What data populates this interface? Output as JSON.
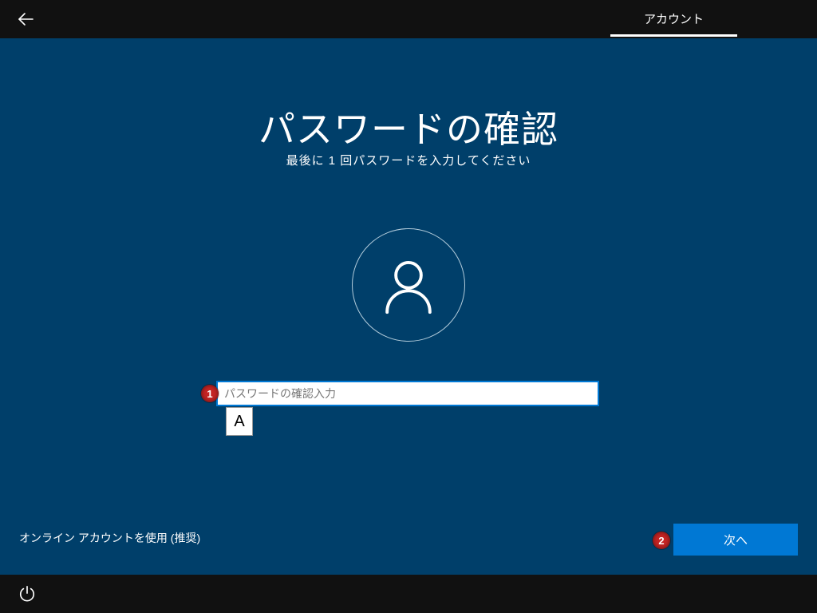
{
  "header": {
    "tab_label": "アカウント"
  },
  "main": {
    "title": "パスワードの確認",
    "subtitle": "最後に 1 回パスワードを入力してください",
    "password_placeholder": "パスワードの確認入力",
    "ime_indicator": "A"
  },
  "callouts": {
    "one": "1",
    "two": "2"
  },
  "footer": {
    "online_account_link": "オンライン アカウントを使用 (推奨)",
    "next_button": "次へ"
  }
}
